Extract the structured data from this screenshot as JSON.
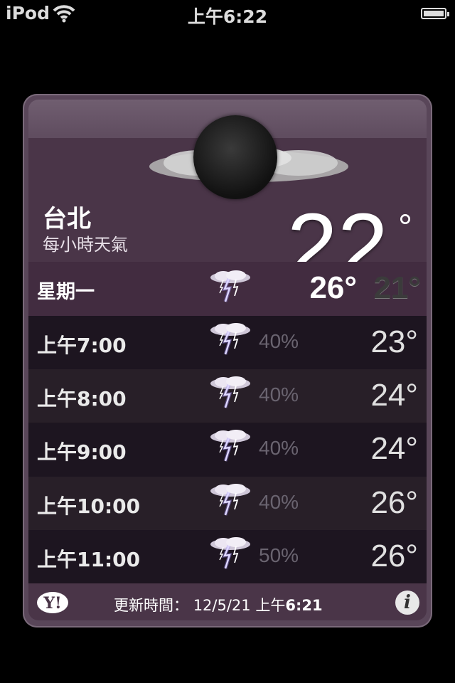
{
  "status_bar": {
    "carrier": "iPod",
    "time": "上午6:22",
    "wifi_icon": "wifi-icon",
    "battery_icon": "battery-icon",
    "battery_level": 1.0
  },
  "weather": {
    "city": "台北",
    "subtitle": "每小時天氣",
    "current_temp": "22",
    "degree_symbol": "°",
    "condition_icon": "moon-cloudy-icon",
    "today": {
      "label": "星期一",
      "icon": "thunderstorm-icon",
      "high": "26°",
      "low": "21°"
    },
    "hourly": [
      {
        "time": "上午7:00",
        "icon": "thunderstorm-icon",
        "precip": "40%",
        "temp": "23°"
      },
      {
        "time": "上午8:00",
        "icon": "thunderstorm-icon",
        "precip": "40%",
        "temp": "24°"
      },
      {
        "time": "上午9:00",
        "icon": "thunderstorm-icon",
        "precip": "40%",
        "temp": "24°"
      },
      {
        "time": "上午10:00",
        "icon": "thunderstorm-icon",
        "precip": "40%",
        "temp": "26°"
      },
      {
        "time": "上午11:00",
        "icon": "thunderstorm-icon",
        "precip": "50%",
        "temp": "26°"
      }
    ]
  },
  "footer": {
    "logo": "Y!",
    "updated_label": "更新時間：",
    "updated_date": "12/5/21",
    "updated_ampm": "上午",
    "updated_time": "6:21",
    "info_label": "i"
  },
  "colors": {
    "card_bg": "#594659",
    "header_bg": "#4a3548",
    "day_row_bg": "#422c40",
    "row_dark": "#1d1520",
    "row_light": "#281f28"
  }
}
